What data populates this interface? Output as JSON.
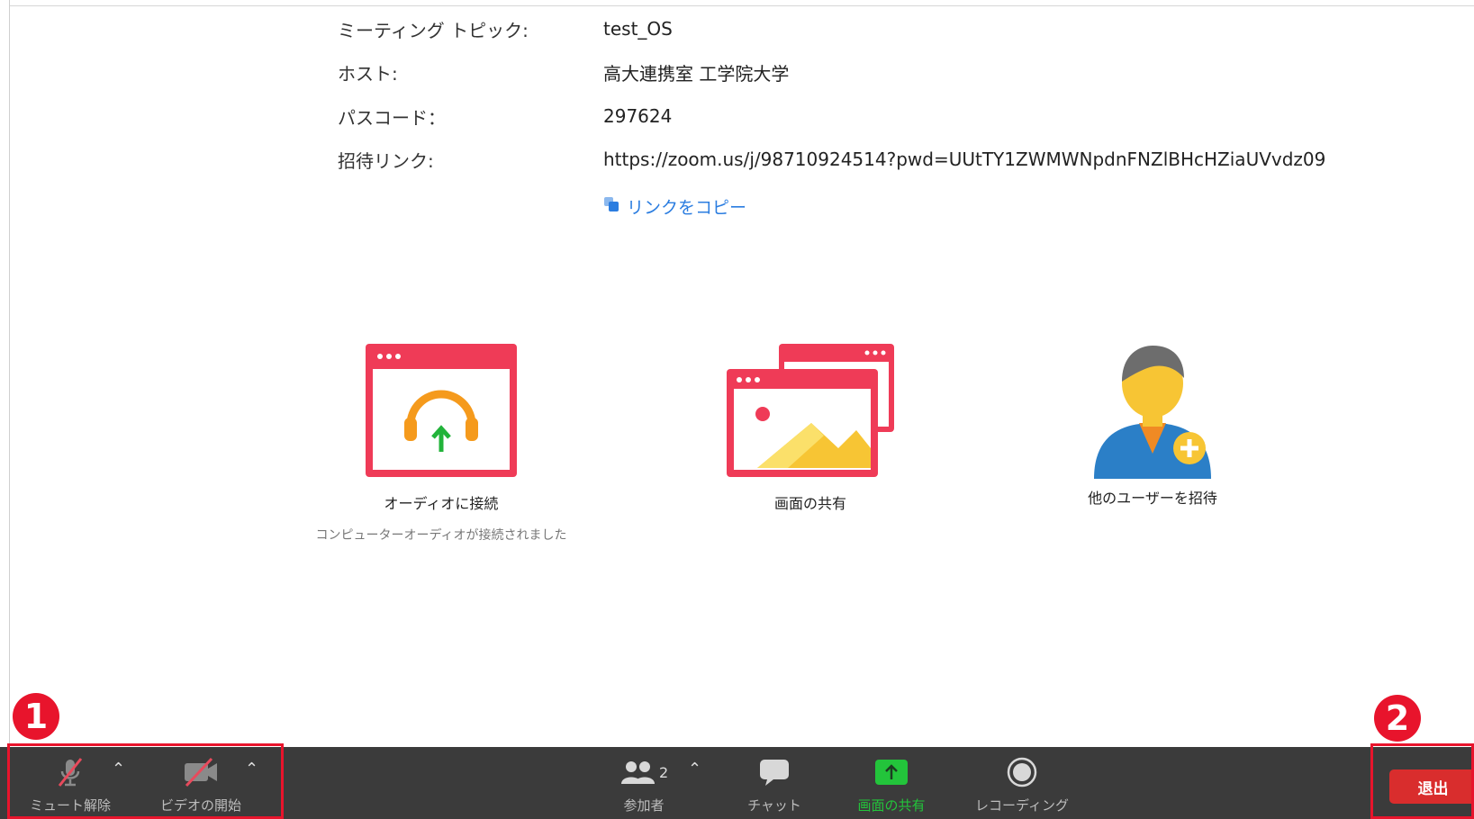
{
  "meeting_info": {
    "rows": [
      {
        "label": "ミーティング トピック:",
        "value": "test_OS"
      },
      {
        "label": "ホスト:",
        "value": "高大連携室 工学院大学"
      },
      {
        "label": "パスコード：",
        "value": "297624"
      },
      {
        "label": "招待リンク:",
        "value": "https://zoom.us/j/98710924514?pwd=UUtTY1ZWMWNpdnFNZlBHcHZiaUVvdz09"
      }
    ],
    "copy_link_label": "リンクをコピー"
  },
  "actions": {
    "audio": {
      "label": "オーディオに接続",
      "sub": "コンピューターオーディオが接続されました"
    },
    "share": {
      "label": "画面の共有"
    },
    "invite": {
      "label": "他のユーザーを招待"
    }
  },
  "toolbar": {
    "mute_label": "ミュート解除",
    "video_label": "ビデオの開始",
    "participants_label": "参加者",
    "participants_count": "2",
    "chat_label": "チャット",
    "share_label": "画面の共有",
    "record_label": "レコーディング",
    "exit_label": "退出"
  },
  "markers": {
    "one": "1",
    "two": "2"
  },
  "colors": {
    "accent_red": "#e8142c",
    "share_green": "#23c43b",
    "link_blue": "#2b7de0",
    "toolbar_bg": "#3b3b3b"
  }
}
